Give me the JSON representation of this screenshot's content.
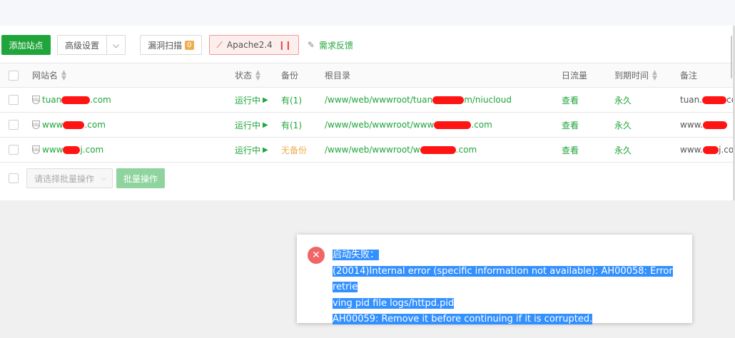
{
  "toolbar": {
    "add_site": "添加站点",
    "advanced": "高级设置",
    "vuln_scan": "漏洞扫描",
    "vuln_count": "0",
    "apache": "Apache2.4",
    "feedback": "需求反馈"
  },
  "table": {
    "headers": {
      "name": "网站名",
      "status": "状态",
      "backup": "备份",
      "root": "根目录",
      "traffic": "日流量",
      "expire": "到期时间",
      "note": "备注"
    },
    "rows": [
      {
        "name_prefix": "tuan",
        "name_suffix": ".com",
        "status": "运行中",
        "backup": "有(1)",
        "root_prefix": "/www/web/wwwroot/tuan",
        "root_suffix": "m/niucloud",
        "traffic": "查看",
        "expire": "永久",
        "note_prefix": "tuan.",
        "note_suffix": "co"
      },
      {
        "name_prefix": "www",
        "name_suffix": ".com",
        "status": "运行中",
        "backup": "有(1)",
        "root_prefix": "/www/web/wwwroot/www",
        "root_suffix": ".com",
        "traffic": "查看",
        "expire": "永久",
        "note_prefix": "www.",
        "note_suffix": ""
      },
      {
        "name_prefix": "www",
        "name_suffix": "j.com",
        "status": "运行中",
        "backup": "无备份",
        "root_prefix": "/www/web/wwwroot/w",
        "root_suffix": ".com",
        "traffic": "查看",
        "expire": "永久",
        "note_prefix": "www.",
        "note_suffix": "j.co"
      }
    ]
  },
  "batch": {
    "select_placeholder": "请选择批量操作",
    "button": "批量操作"
  },
  "error": {
    "line1": "启动失败：",
    "line2": "(20014)Internal error (specific information not available): AH00058: Error retrie",
    "line3": "ving pid file logs/httpd.pid",
    "line4": "AH00059: Remove it before continuing if it is corrupted."
  },
  "colors": {
    "accent": "#20a53a",
    "warning": "#f0ad4e",
    "error": "#f06565",
    "selection": "#3390ff"
  }
}
